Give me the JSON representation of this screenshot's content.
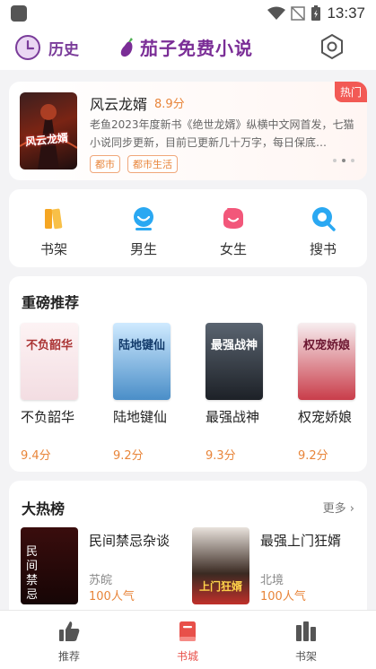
{
  "statusbar": {
    "time": "13:37"
  },
  "appbar": {
    "history_label": "历史",
    "title": "茄子免费小说"
  },
  "featured": {
    "badge": "热门",
    "cover_text": "风云龙婿",
    "title": "风云龙婿",
    "score": "8.9分",
    "description": "老鱼2023年度新书《绝世龙婿》纵横中文网首发，七猫小说同步更新，目前已更新几十万字，每日保底…",
    "tags": [
      "都市",
      "都市生活"
    ]
  },
  "quick_nav": [
    {
      "label": "书架",
      "icon": "bookshelf-icon",
      "color": "#f5a623"
    },
    {
      "label": "男生",
      "icon": "male-icon",
      "color": "#2aa8f2"
    },
    {
      "label": "女生",
      "icon": "female-icon",
      "color": "#f2577a"
    },
    {
      "label": "搜书",
      "icon": "search-icon",
      "color": "#2aa8f2"
    }
  ],
  "recommend": {
    "title": "重磅推荐",
    "books": [
      {
        "title": "不负韶华",
        "score": "9.4分",
        "cover_text": "不负韶华"
      },
      {
        "title": "陆地键仙",
        "score": "9.2分",
        "cover_text": "陆地键仙"
      },
      {
        "title": "最强战神",
        "score": "9.3分",
        "cover_text": "最强战神"
      },
      {
        "title": "权宠娇娘",
        "score": "9.2分",
        "cover_text": "权宠娇娘"
      }
    ]
  },
  "hot_list": {
    "title": "大热榜",
    "more_label": "更多",
    "items": [
      {
        "title": "民间禁忌杂谈",
        "author": "苏皖",
        "popularity": "100人气",
        "cover_text": "民间禁忌"
      },
      {
        "title": "最强上门狂婿",
        "author": "北境",
        "popularity": "100人气",
        "cover_text": "上门狂婿"
      }
    ]
  },
  "tabbar": {
    "tabs": [
      {
        "label": "推荐"
      },
      {
        "label": "书城"
      },
      {
        "label": "书架"
      }
    ],
    "active_color": "#e8504a"
  }
}
